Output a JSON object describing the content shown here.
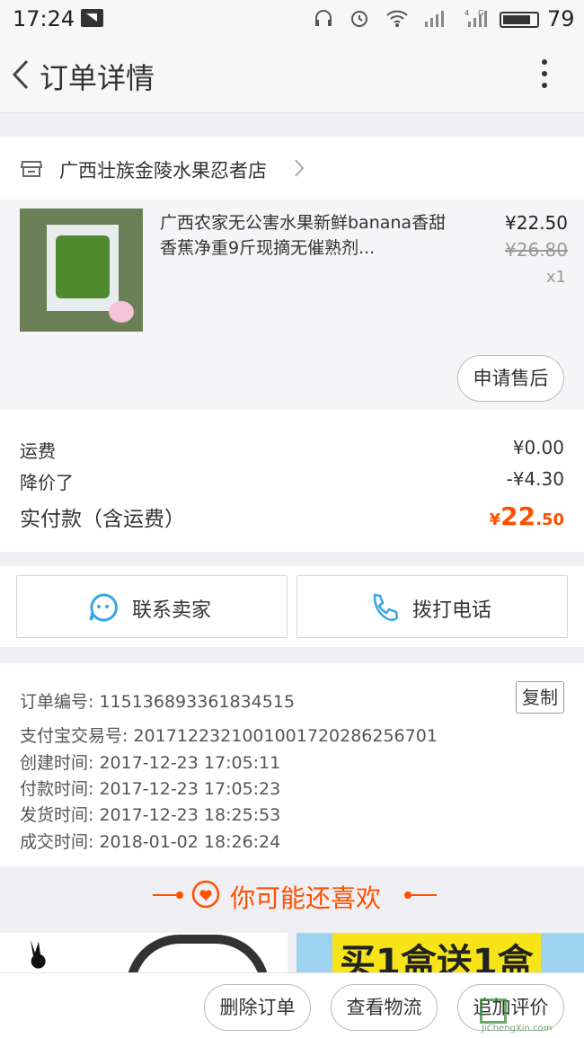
{
  "status_bar": {
    "time": "17:24",
    "network": "4G",
    "battery": "79"
  },
  "nav": {
    "title": "订单详情"
  },
  "shop": {
    "name": "广西壮族金陵水果忍者店"
  },
  "item": {
    "title": "广西农家无公害水果新鲜banana香甜香蕉净重9斤现摘无催熟剂...",
    "price": "¥22.50",
    "original_price": "¥26.80",
    "quantity": "x1",
    "after_sale_label": "申请售后"
  },
  "fees": {
    "shipping_label": "运费",
    "shipping_value": "¥0.00",
    "discount_label": "降价了",
    "discount_value": "-¥4.30",
    "total_label": "实付款（含运费）",
    "total_symbol": "¥",
    "total_int": "22",
    "total_dec": ".50"
  },
  "contact": {
    "seller_label": "联系卖家",
    "phone_label": "拨打电话"
  },
  "order_info": {
    "order_no": "订单编号: 115136893361834515",
    "copy_label": "复制",
    "alipay_no": "支付宝交易号: 2017122321001001720286256701",
    "created": "创建时间: 2017-12-23 17:05:11",
    "paid": "付款时间: 2017-12-23 17:05:23",
    "shipped": "发货时间: 2017-12-23 18:25:53",
    "completed": "成交时间: 2018-01-02 18:26:24"
  },
  "recommend": {
    "heading": "你可能还喜欢",
    "promo_text": "买1盒送1盒"
  },
  "bottom_actions": {
    "delete_label": "删除订单",
    "logistics_label": "查看物流",
    "review_label": "追加评价"
  },
  "watermark": {
    "text": "JiChengXin.com"
  },
  "colors": {
    "accent": "#ff5000",
    "page_bg": "#f0eff4"
  }
}
